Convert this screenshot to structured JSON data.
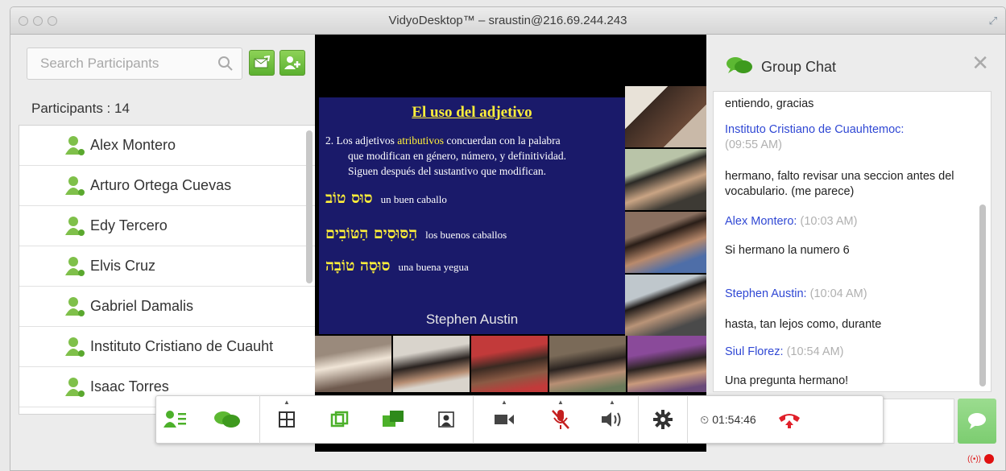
{
  "window": {
    "title": "VidyoDesktop™ – sraustin@216.69.244.243"
  },
  "left_panel": {
    "search_placeholder": "Search Participants",
    "participants_label": "Participants : 14",
    "participants": [
      "Alex Montero",
      "Arturo  Ortega Cuevas",
      "Edy Tercero",
      "Elvis Cruz",
      "Gabriel Damalis",
      "Instituto Cristiano de Cuauht",
      "Isaac Torres"
    ]
  },
  "video": {
    "slide_title": "El uso del adjetivo",
    "slide_line1_a": "2. Los adjetivos ",
    "slide_line1_b": "atributivos",
    "slide_line1_c": " concuerdan con la palabra",
    "slide_line2": "que modifican en género, número, y definitividad.",
    "slide_line3": "Siguen después del sustantivo que modifican.",
    "heb1": "סוּס טוֹב",
    "heb1_text": "un buen caballo",
    "heb2": "הַסּוּסִים הַטּוֹבִים",
    "heb2_text": "los buenos caballos",
    "heb3": "סוּסָה טוֹבָה",
    "heb3_text": "una buena yegua",
    "speaker": "Stephen Austin"
  },
  "chat": {
    "title": "Group Chat",
    "messages": [
      {
        "text": "entiendo, gracias"
      },
      {
        "sender": "Instituto Cristiano de Cuauhtemoc:",
        "time": "(09:55 AM)"
      },
      {
        "text": "hermano, falto revisar una seccion antes del vocabulario. (me parece)"
      },
      {
        "sender": "Alex Montero:",
        "time": "(10:03 AM)"
      },
      {
        "text": "Si hermano la numero 6"
      },
      {
        "sender": "Stephen Austin:",
        "time": "(10:04 AM)"
      },
      {
        "text": "hasta, tan lejos como, durante"
      },
      {
        "sender": "Siul Florez:",
        "time": "(10:54 AM)"
      },
      {
        "text": "Una pregunta hermano!"
      }
    ]
  },
  "toolbar": {
    "timer": "01:54:46"
  },
  "colors": {
    "accent_green": "#5bb030",
    "sender_blue": "#3048d4",
    "hangup_red": "#e0202a",
    "slide_bg": "#1a1a6a",
    "slide_highlight": "#ffef3a"
  }
}
